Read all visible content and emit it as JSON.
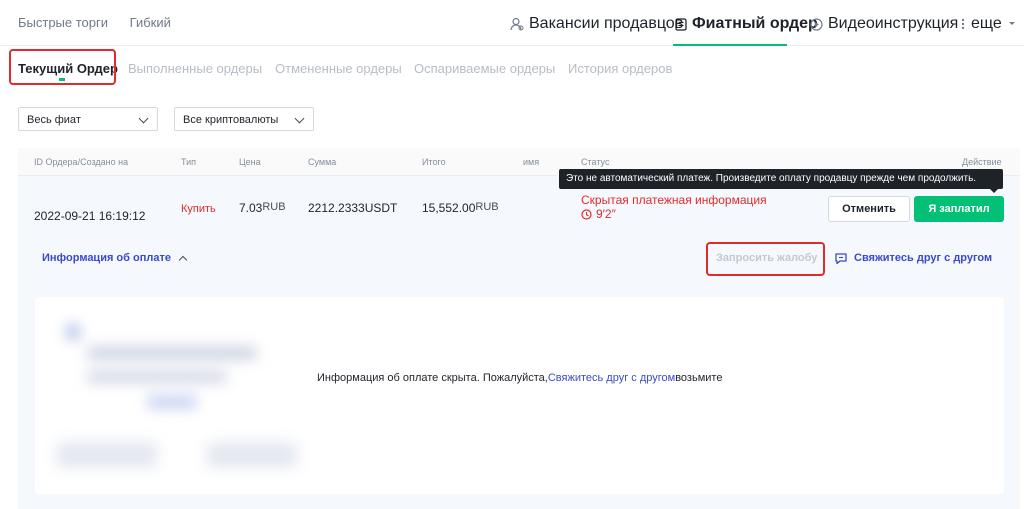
{
  "topnav": {
    "left": [
      "Быстрые торги",
      "Гибкий"
    ],
    "right": {
      "vacancies": "Вакансии продавцов",
      "fiat_order": "Фиатный ордер",
      "video": "Видеоинструкция",
      "more": "еще"
    }
  },
  "subtabs": [
    "Текущий Ордер",
    "Выполненные ордеры",
    "Отмененные ордеры",
    "Оспариваемые ордеры",
    "История ордеров"
  ],
  "filters": {
    "fiat": "Весь фиат",
    "crypto": "Все криптовалюты"
  },
  "table": {
    "headers": {
      "id": "ID Ордера/Создано на",
      "type": "Тип",
      "price": "Цена",
      "amount": "Сумма",
      "total": "Итого",
      "name": "имя",
      "status": "Статус",
      "action": "Действие"
    },
    "row": {
      "datetime": "2022-09-21 16:19:12",
      "type": "Купить",
      "price": "7.03",
      "price_unit": "RUB",
      "amount": "2212.2333USDT",
      "total": "15,552.00",
      "total_unit": "RUB",
      "status": "Скрытая платежная информация",
      "timer": "9′2″",
      "cancel": "Отменить",
      "paid": "Я заплатил"
    },
    "tooltip": "Это не автоматический платеж. Произведите оплату продавцу прежде чем продолжить.",
    "payinfo": "Информация об оплате",
    "complaint": "Запросить жалобу",
    "contact": "Свяжитесь друг с другом",
    "hidden_msg_prefix": "Информация об оплате скрыта. Пожалуйста,",
    "hidden_msg_link": "Свяжитесь друг с другом",
    "hidden_msg_suffix": "возьмите"
  },
  "colors": {
    "accent": "#02c076",
    "sell": "#e02b2b",
    "link": "#3b4aca",
    "highlight": "#e02b2b"
  }
}
